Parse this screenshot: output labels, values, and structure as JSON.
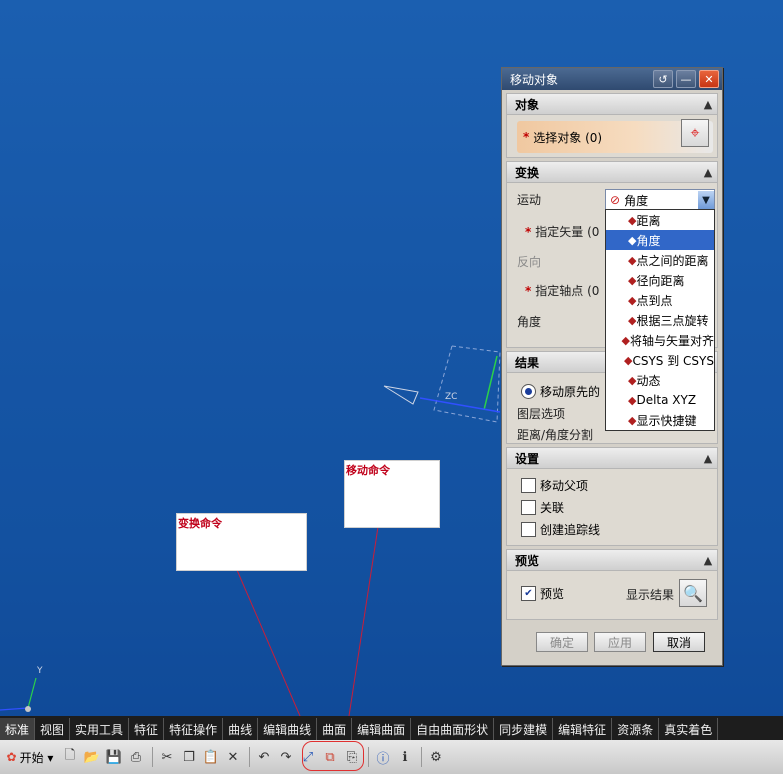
{
  "dialog": {
    "title": "移动对象",
    "sections": {
      "object": {
        "title": "对象",
        "select_label": "选择对象 (0)"
      },
      "transform": {
        "title": "变换",
        "motion_label": "运动",
        "motion_value": "角度",
        "vector_label": "指定矢量 (0",
        "reverse_label": "反向",
        "axis_point_label": "指定轴点 (0",
        "angle_label": "角度"
      },
      "result": {
        "title": "结果",
        "move_original_label": "移动原先的",
        "layer_option_label": "图层选项",
        "distance_angle_label": "距离/角度分割"
      },
      "settings": {
        "title": "设置",
        "move_parent_label": "移动父项",
        "associate_label": "关联",
        "create_trace_label": "创建追踪线"
      },
      "preview": {
        "title": "预览",
        "preview_label": "预览",
        "show_result_label": "显示结果"
      }
    },
    "buttons": {
      "ok": "确定",
      "apply": "应用",
      "cancel": "取消"
    },
    "dropdown_items": [
      {
        "label": "距离",
        "icon": "distance-icon",
        "selected": false
      },
      {
        "label": "角度",
        "icon": "angle-icon",
        "selected": true
      },
      {
        "label": "点之间的距离",
        "icon": "point-distance-icon",
        "selected": false
      },
      {
        "label": "径向距离",
        "icon": "radial-distance-icon",
        "selected": false
      },
      {
        "label": "点到点",
        "icon": "point-to-point-icon",
        "selected": false
      },
      {
        "label": "根据三点旋转",
        "icon": "three-point-rotate-icon",
        "selected": false
      },
      {
        "label": "将轴与矢量对齐",
        "icon": "align-axis-icon",
        "selected": false
      },
      {
        "label": "CSYS 到 CSYS",
        "icon": "csys-icon",
        "selected": false
      },
      {
        "label": "动态",
        "icon": "dynamic-icon",
        "selected": false
      },
      {
        "label": "Delta XYZ",
        "icon": "delta-xyz-icon",
        "selected": false
      },
      {
        "label": "显示快捷键",
        "icon": "shortcut-icon",
        "selected": false
      }
    ]
  },
  "callouts": {
    "transform": "变换命令",
    "move": "移动命令"
  },
  "viewport_labels": {
    "zc": "ZC",
    "y_axis": "Y"
  },
  "tabs": [
    "标准",
    "视图",
    "实用工具",
    "特征",
    "特征操作",
    "曲线",
    "编辑曲线",
    "曲面",
    "编辑曲面",
    "自由曲面形状",
    "同步建模",
    "编辑特征",
    "资源条",
    "真实着色"
  ],
  "toolbar": {
    "start_label": "开始 ▾"
  },
  "colors": {
    "accent_selected": "#3167c8",
    "callout_text": "#c0001a",
    "highlight": "#e03030"
  }
}
